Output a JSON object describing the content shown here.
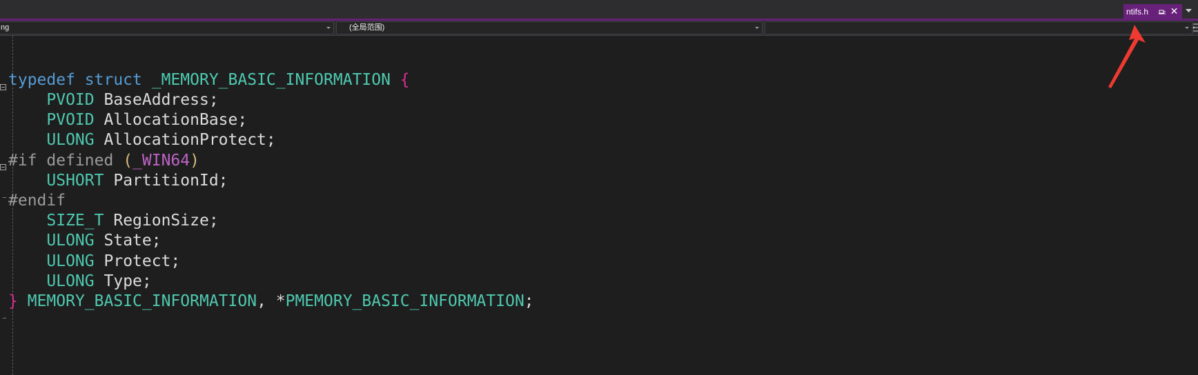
{
  "tab": {
    "title": "ntifs.h",
    "pin_icon": "pin-icon",
    "close_glyph": "✕"
  },
  "navbar": {
    "project_value": "ng",
    "scope_value": "(全局范围)",
    "member_value": ""
  },
  "colors": {
    "accent": "#68217a",
    "keyword": "#569cd6",
    "type": "#4ec9b0",
    "brace": "#da2f91",
    "preprocessor": "#9b9b9b",
    "macro": "#bd63c5",
    "annotation_arrow": "#ee3a30"
  },
  "code": {
    "l1_kw1": "typedef",
    "l1_kw2": "struct",
    "l1_name": "_MEMORY_BASIC_INFORMATION",
    "l1_brace": "{",
    "l2_type": "PVOID",
    "l2_field": "BaseAddress;",
    "l3_type": "PVOID",
    "l3_field": "AllocationBase;",
    "l4_type": "ULONG",
    "l4_field": "AllocationProtect;",
    "l5_directive": "#if defined",
    "l5_open": "(",
    "l5_macro": "_WIN64",
    "l5_close": ")",
    "l6_type": "USHORT",
    "l6_field": "PartitionId;",
    "l7_directive": "#endif",
    "l8_type": "SIZE_T",
    "l8_field": "RegionSize;",
    "l9_type": "ULONG",
    "l9_field": "State;",
    "l10_type": "ULONG",
    "l10_field": "Protect;",
    "l11_type": "ULONG",
    "l11_field": "Type;",
    "l12_brace": "}",
    "l12_name1": "MEMORY_BASIC_INFORMATION",
    "l12_sep": ", *",
    "l12_name2": "PMEMORY_BASIC_INFORMATION",
    "l12_end": ";"
  }
}
